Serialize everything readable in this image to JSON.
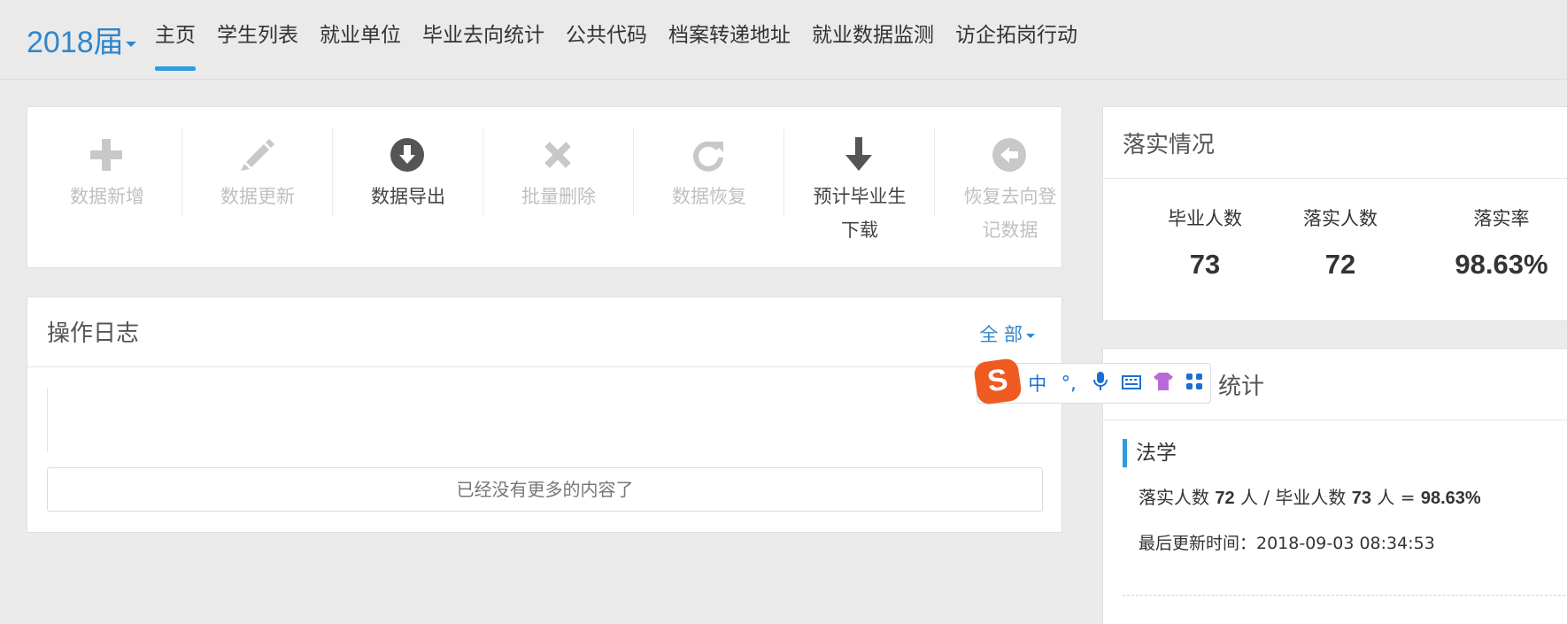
{
  "header": {
    "year_label": "2018届",
    "nav": [
      {
        "label": "主页",
        "active": true
      },
      {
        "label": "学生列表"
      },
      {
        "label": "就业单位"
      },
      {
        "label": "毕业去向统计"
      },
      {
        "label": "公共代码"
      },
      {
        "label": "档案转递地址"
      },
      {
        "label": "就业数据监测"
      },
      {
        "label": "访企拓岗行动"
      }
    ]
  },
  "toolbar": {
    "items": [
      {
        "line1": "数据新增",
        "line2": "",
        "icon": "plus-icon",
        "enabled": false
      },
      {
        "line1": "数据更新",
        "line2": "",
        "icon": "pencil-icon",
        "enabled": false
      },
      {
        "line1": "数据导出",
        "line2": "",
        "icon": "download-circle-icon",
        "enabled": true
      },
      {
        "line1": "批量删除",
        "line2": "",
        "icon": "cross-icon",
        "enabled": false
      },
      {
        "line1": "数据恢复",
        "line2": "",
        "icon": "refresh-icon",
        "enabled": false
      },
      {
        "line1": "预计毕业生",
        "line2": "下载",
        "icon": "arrow-down-icon",
        "enabled": true
      },
      {
        "line1": "恢复去向登",
        "line2": "记数据",
        "icon": "back-circle-icon",
        "enabled": false
      }
    ]
  },
  "log": {
    "title": "操作日志",
    "filter": "全 部",
    "no_more": "已经没有更多的内容了"
  },
  "stats": {
    "title": "落实情况",
    "graduates_label": "毕业人数",
    "graduates_value": "73",
    "placed_label": "落实人数",
    "placed_value": "72",
    "rate_label": "落实率",
    "rate_value": "98.63%"
  },
  "detail": {
    "title_visible": "统计",
    "major": "法学",
    "summary_prefix": "落实人数",
    "summary_placed": "72",
    "summary_mid": "人 / 毕业人数",
    "summary_total": "73",
    "summary_suffix": "人 =",
    "summary_rate": "98.63%",
    "updated": "最后更新时间：2018-09-03 08:34:53"
  },
  "ime": {
    "items": [
      "中",
      "°,",
      "mic-icon",
      "keyboard-icon",
      "shirt-icon",
      "apps-icon"
    ],
    "labels": [
      "中",
      "°,"
    ]
  },
  "colors": {
    "accent": "#2f86cc",
    "nav_underline": "#2f9be0",
    "disabled": "#c0c0c0",
    "ime_brand": "#ef5a21"
  }
}
